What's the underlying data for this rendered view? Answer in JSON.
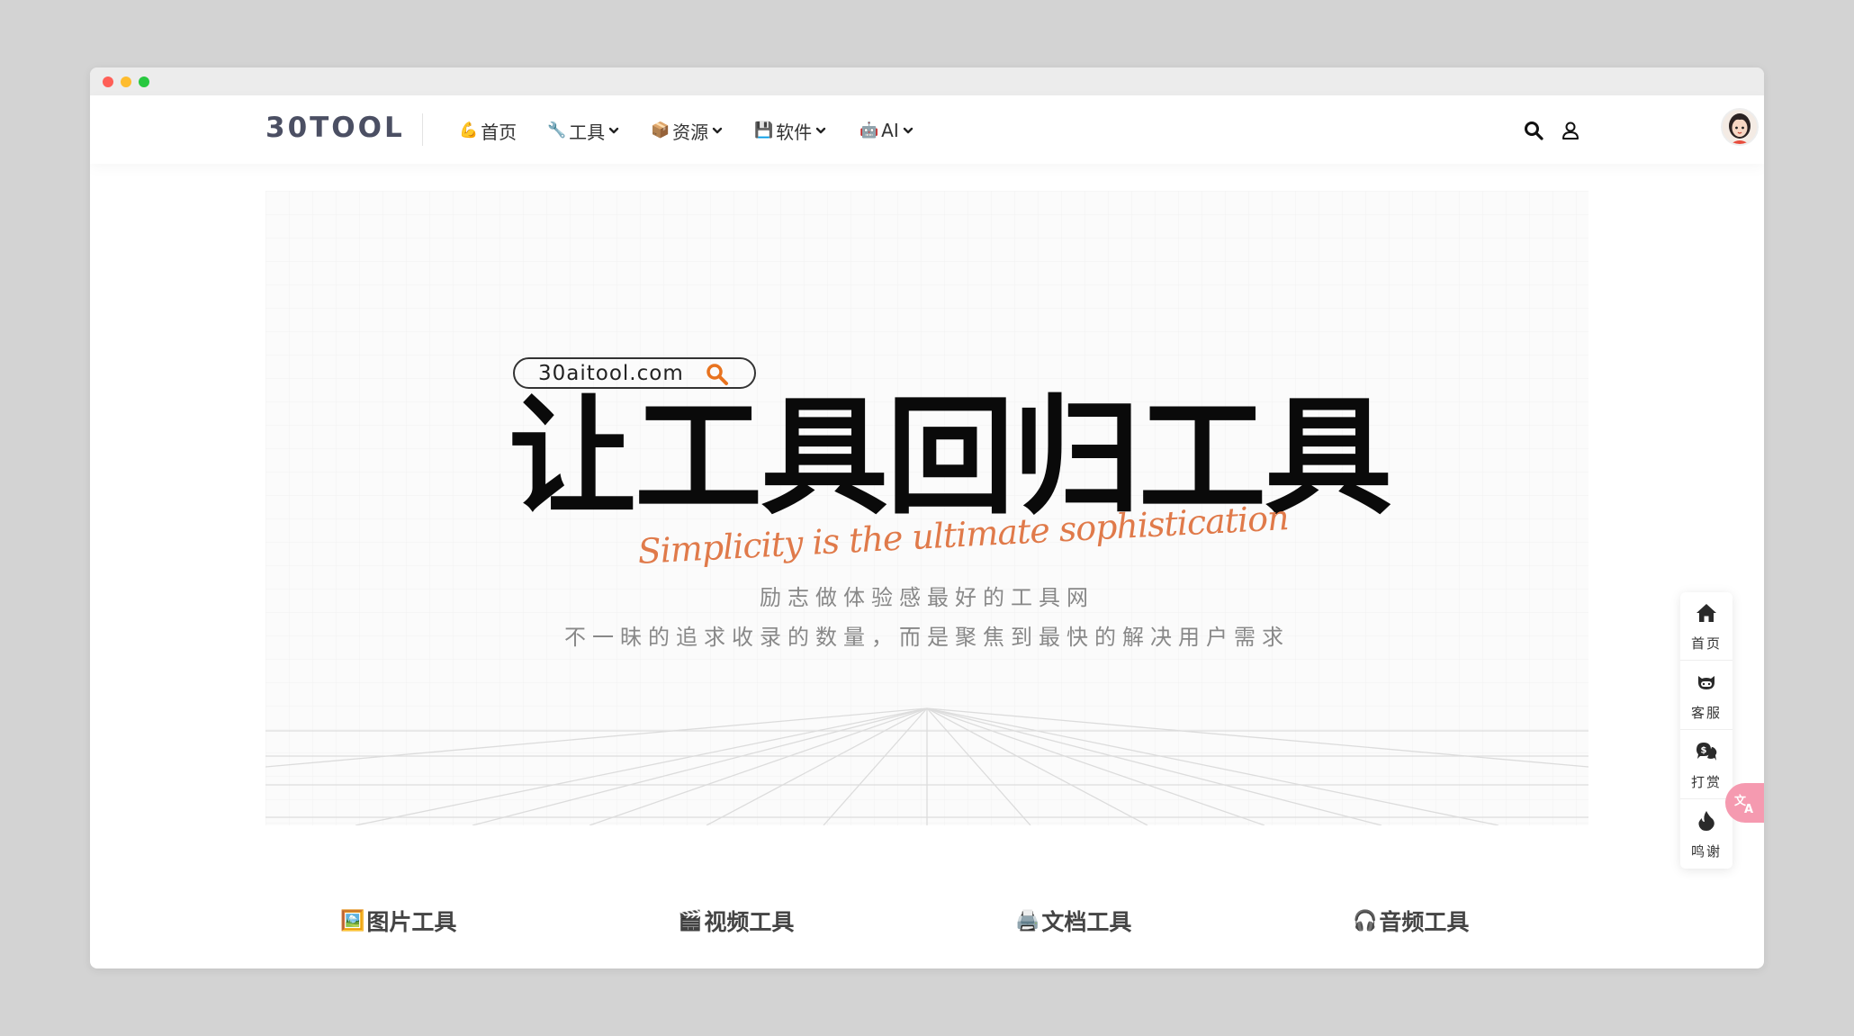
{
  "window": {
    "controls": [
      "close",
      "minimize",
      "maximize"
    ]
  },
  "navbar": {
    "logo": "30TOOL",
    "items": [
      {
        "label": "首页",
        "icon": "flexed-biceps-emoji",
        "has_dropdown": false
      },
      {
        "label": "工具",
        "icon": "wrench-emoji",
        "has_dropdown": true
      },
      {
        "label": "资源",
        "icon": "package-emoji",
        "has_dropdown": true
      },
      {
        "label": "软件",
        "icon": "floppy-disk-emoji",
        "has_dropdown": true
      },
      {
        "label": "AI",
        "icon": "robot-emoji",
        "has_dropdown": true
      }
    ],
    "search_icon": "search-icon",
    "user_icon": "user-icon",
    "avatar": "avatar"
  },
  "banner": {
    "domain": "30aitool.com",
    "headline": "让工具回归工具",
    "slogan": "Simplicity is the ultimate sophistication",
    "subtitle1": "励志做体验感最好的工具网",
    "subtitle2": "不一昧的追求收录的数量，而是聚焦到最快的解决用户需求",
    "accent_color": "#e07a4a"
  },
  "categories": [
    {
      "label": "图片工具",
      "icon": "framed-picture-emoji"
    },
    {
      "label": "视频工具",
      "icon": "clapper-board-emoji"
    },
    {
      "label": "文档工具",
      "icon": "printer-emoji"
    },
    {
      "label": "音频工具",
      "icon": "headphones-emoji"
    }
  ],
  "sidebar": {
    "items": [
      {
        "label": "首页",
        "icon": "home-icon"
      },
      {
        "label": "客服",
        "icon": "github-icon"
      },
      {
        "label": "打赏",
        "icon": "donate-icon"
      },
      {
        "label": "鸣谢",
        "icon": "flame-icon"
      }
    ],
    "translate_icon": "translate-icon",
    "translate_color": "#f59ab0"
  }
}
